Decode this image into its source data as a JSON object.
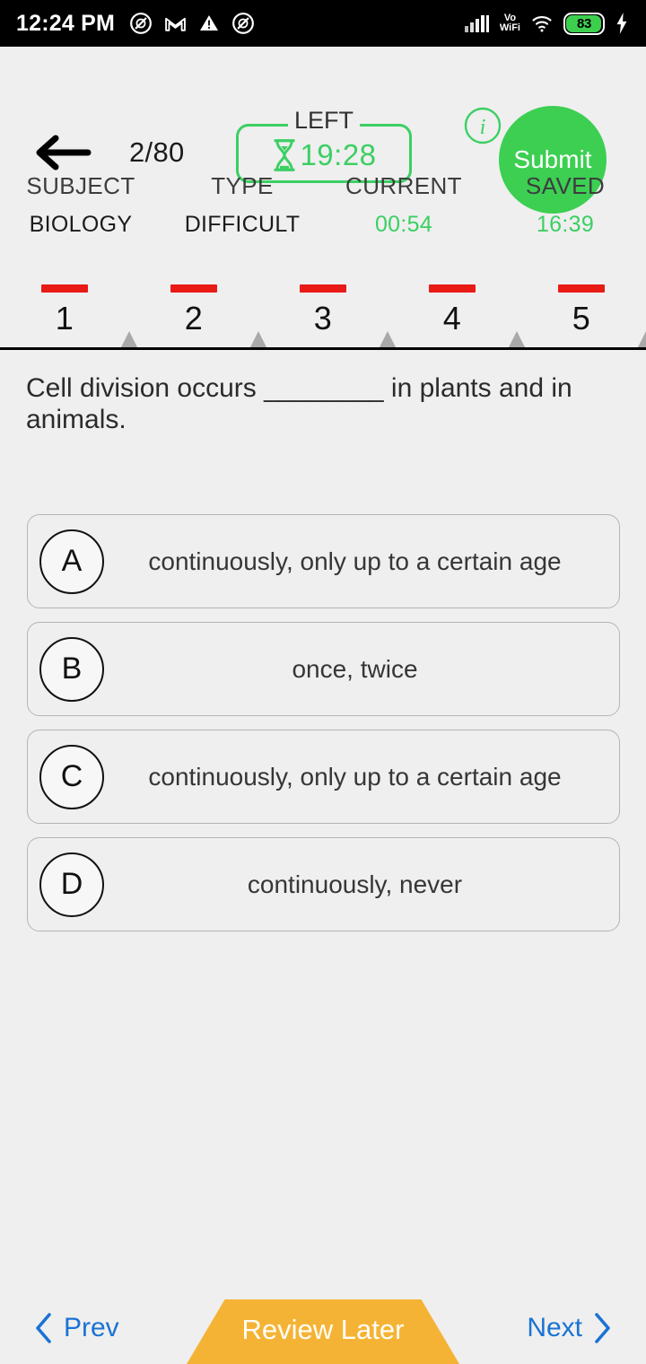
{
  "statusbar": {
    "clock": "12:24 PM",
    "left_icons": [
      "do-not-disturb-icon",
      "gmail-icon",
      "warning-triangle-icon",
      "do-not-disturb-icon"
    ],
    "signal": "signal-bars-icon",
    "volte_line1": "Vo",
    "volte_line2": "WiFi",
    "wifi": "wifi-icon",
    "battery_percent": "83",
    "charging": "charging-bolt-icon"
  },
  "header": {
    "back_label": "back-arrow",
    "question_counter": "2/80",
    "timer_legend": "LEFT",
    "timer_value": "19:28",
    "hourglass": "hourglass-icon",
    "info_label": "i",
    "submit_label": "Submit"
  },
  "meta": [
    {
      "label": "SUBJECT",
      "value": "BIOLOGY",
      "green": false
    },
    {
      "label": "TYPE",
      "value": "DIFFICULT",
      "green": false
    },
    {
      "label": "CURRENT",
      "value": "00:54",
      "green": true
    },
    {
      "label": "SAVED",
      "value": "16:39",
      "green": true
    }
  ],
  "tabs": [
    "1",
    "2",
    "3",
    "4",
    "5"
  ],
  "question": {
    "text": "Cell division occurs ________ in plants and in animals."
  },
  "options": [
    {
      "letter": "A",
      "text": "continuously, only up to a certain age"
    },
    {
      "letter": "B",
      "text": "once, twice"
    },
    {
      "letter": "C",
      "text": "continuously, only up to a certain age"
    },
    {
      "letter": "D",
      "text": "continuously, never"
    }
  ],
  "bottom": {
    "prev_label": "Prev",
    "review_label": "Review Later",
    "next_label": "Next"
  },
  "colors": {
    "accent_green": "#3ccf63",
    "submit_green": "#3ccf52",
    "tab_red": "#e81b16",
    "link_blue": "#1a73d4",
    "review_orange": "#f5b335",
    "page_bg": "#efefef"
  }
}
